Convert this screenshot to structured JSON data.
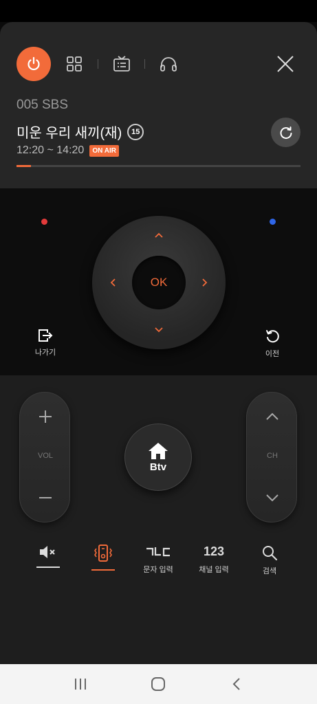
{
  "remote": {
    "channel": "005 SBS",
    "program_title": "미운 우리 새끼(재)",
    "age_rating": "15",
    "time_range": "12:20 ~ 14:20",
    "onair_label": "ON AIR",
    "progress": 0.05
  },
  "dpad": {
    "ok_label": "OK",
    "exit_label": "나가기",
    "back_label": "이전"
  },
  "controls": {
    "vol_label": "VOL",
    "ch_label": "CH",
    "home_label": "Btv"
  },
  "functions": {
    "text_input_label": "문자 입력",
    "channel_input_label": "채널 입력",
    "channel_input_icon_text": "123",
    "search_label": "검색"
  },
  "colors": {
    "accent": "#f26b3a",
    "red_key": "#e33a3a",
    "blue_key": "#2f66e8"
  }
}
